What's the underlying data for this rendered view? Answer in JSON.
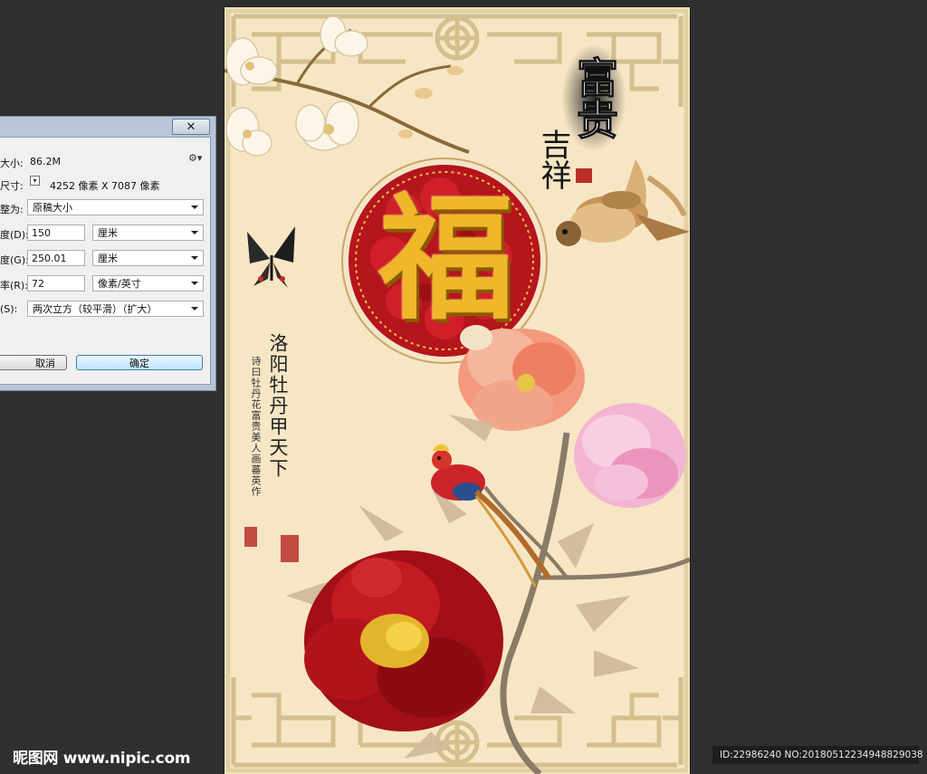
{
  "dialog": {
    "close_label": "✕",
    "file_size_label": "大小:",
    "file_size_value": "86.2M",
    "dimensions_label": "尺寸:",
    "dimensions_value": "4252 像素  X  7087 像素",
    "fit_label": "整为:",
    "fit_value": "原稿大小",
    "width_label": "度(D):",
    "width_value": "150",
    "width_unit": "厘米",
    "height_label": "度(G):",
    "height_value": "250.01",
    "height_unit": "厘米",
    "resolution_label": "率(R):",
    "resolution_value": "72",
    "resolution_unit": "像素/英寸",
    "resample_label": "(S):",
    "resample_value": "两次立方（较平滑）（扩大）",
    "cancel_label": "取消",
    "ok_label": "确定"
  },
  "artwork": {
    "title_chars": "富贵",
    "subtitle_chars": "吉祥",
    "center_char": "福",
    "poem_title": "洛阳牡丹甲天下",
    "poem_body": "诗曰牡丹花富贵美人画蕃英作",
    "seal_text": "印"
  },
  "watermark": {
    "site": "昵图网 www.nipic.com",
    "id_text": "ID:22986240 NO:20180512234948829038"
  },
  "colors": {
    "background": "#2f2f2f",
    "canvas": "#f7e6c4",
    "lattice": "#d9c79b",
    "medallion_red": "#b5151c",
    "gold": "#e0a81a",
    "dialog_frame": "#b8c6d7"
  }
}
